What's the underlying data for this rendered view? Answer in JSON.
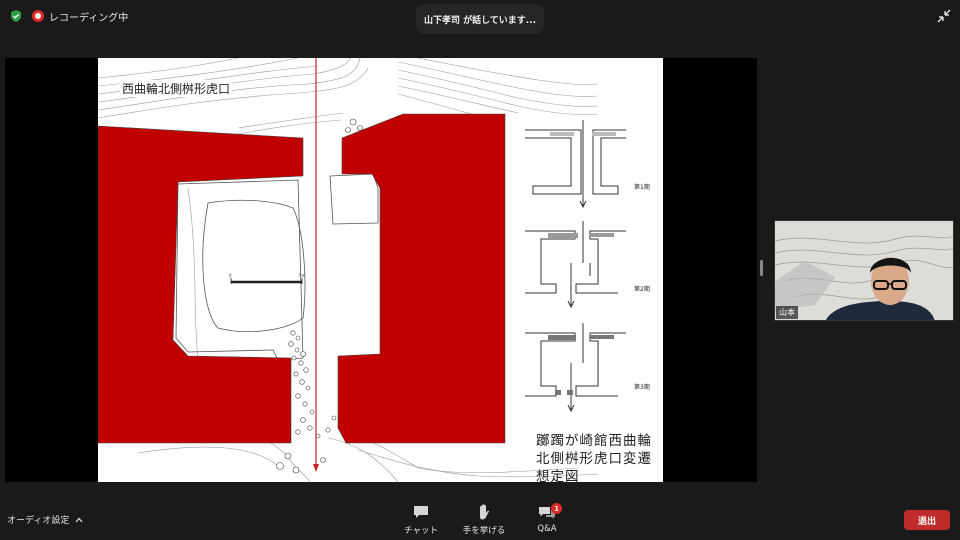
{
  "topbar": {
    "recording_label": "レコーディング中",
    "speaker_text": "山下孝司 が話しています..."
  },
  "slide": {
    "title": "西曲輪北側桝形虎口",
    "scale_start": "0",
    "scale_end": "5m",
    "phases": [
      "第1期",
      "第2期",
      "第3期"
    ],
    "caption": "躑躅が崎館西曲輪北側桝形虎口変遷想定図",
    "highlight_color": "#c00000"
  },
  "participant": {
    "name": "山本"
  },
  "toolbar": {
    "audio_settings_label": "オーディオ設定",
    "chat_label": "チャット",
    "raise_hand_label": "手を挙げる",
    "qa_label": "Q&A",
    "qa_badge": "1",
    "leave_label": "退出"
  },
  "icons": {
    "security": "shield-icon",
    "recording": "record-icon",
    "exit_fullscreen": "exit-fullscreen-icon",
    "chat": "chat-icon",
    "raise_hand": "hand-icon",
    "qa": "qa-icon",
    "audio_chevron": "chevron-up-icon"
  },
  "colors": {
    "leave_button": "#c02b2b",
    "badge": "#e02828",
    "security_shield": "#2ea043"
  }
}
